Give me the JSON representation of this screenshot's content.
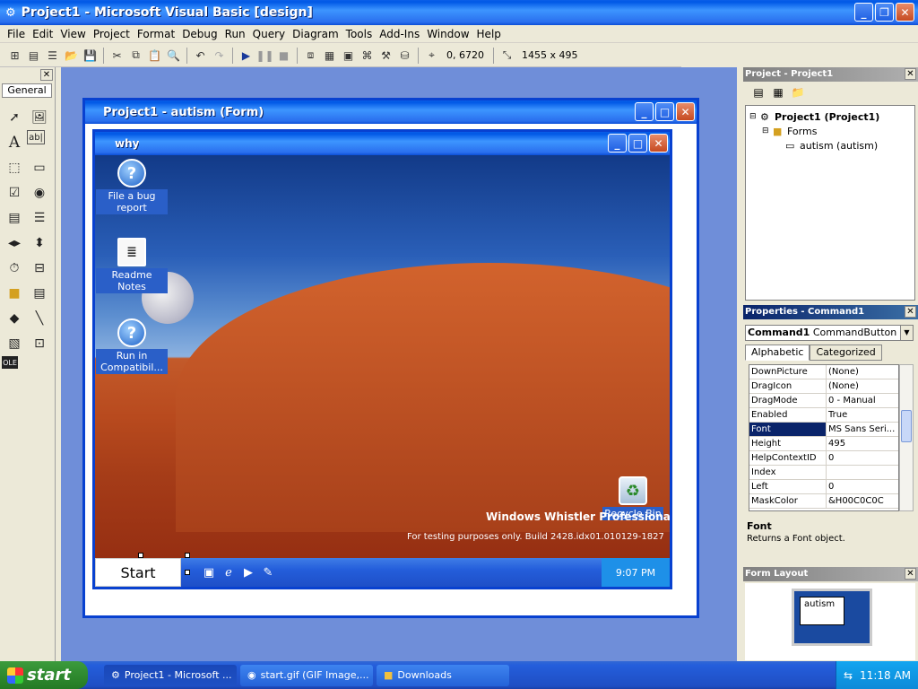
{
  "app": {
    "title": "Project1 - Microsoft Visual Basic [design]"
  },
  "menu": [
    "File",
    "Edit",
    "View",
    "Project",
    "Format",
    "Debug",
    "Run",
    "Query",
    "Diagram",
    "Tools",
    "Add-Ins",
    "Window",
    "Help"
  ],
  "toolbar": {
    "position": "0, 6720",
    "size": "1455 x 495"
  },
  "toolbox": {
    "tab": "General",
    "tools": [
      "pointer-icon",
      "picturebox-icon",
      "label-icon",
      "textbox-icon",
      "frame-icon",
      "commandbutton-icon",
      "checkbox-icon",
      "optionbutton-icon",
      "combobox-icon",
      "listbox-icon",
      "hscrollbar-icon",
      "vscrollbar-icon",
      "timer-icon",
      "drivelist-icon",
      "dirlist-icon",
      "filelist-icon",
      "shape-icon",
      "line-icon",
      "image-icon",
      "data-icon",
      "ole-icon"
    ]
  },
  "form": {
    "title": "Project1 - autism (Form)"
  },
  "why": {
    "title": "why",
    "icons": [
      {
        "label": "File a bug report",
        "icon": "help-shortcut-icon"
      },
      {
        "label": "Readme Notes",
        "icon": "readme-icon"
      },
      {
        "label": "Run in Compatibil...",
        "icon": "help-shortcut-icon"
      },
      {
        "label": "Recycle Bin",
        "icon": "recycle-bin-icon"
      }
    ],
    "brand": "Windows Whistler Professional",
    "build": "For testing purposes only. Build 2428.idx01.010129-1827",
    "start": "Start",
    "clock": "9:07 PM"
  },
  "project_panel": {
    "title": "Project - Project1",
    "tree": [
      {
        "label": "Project1 (Project1)",
        "bold": true
      },
      {
        "label": "Forms",
        "bold": false
      },
      {
        "label": "autism (autism)",
        "bold": false
      }
    ]
  },
  "properties_panel": {
    "title": "Properties - Command1",
    "object_name": "Command1",
    "object_type": "CommandButton",
    "tabs": [
      "Alphabetic",
      "Categorized"
    ],
    "rows": [
      {
        "name": "DownPicture",
        "value": "(None)"
      },
      {
        "name": "DragIcon",
        "value": "(None)"
      },
      {
        "name": "DragMode",
        "value": "0 - Manual"
      },
      {
        "name": "Enabled",
        "value": "True"
      },
      {
        "name": "Font",
        "value": "MS Sans Seri..."
      },
      {
        "name": "Height",
        "value": "495"
      },
      {
        "name": "HelpContextID",
        "value": "0"
      },
      {
        "name": "Index",
        "value": ""
      },
      {
        "name": "Left",
        "value": "0"
      },
      {
        "name": "MaskColor",
        "value": "&H00C0C0C"
      }
    ],
    "desc_title": "Font",
    "desc_text": "Returns a Font object."
  },
  "form_layout": {
    "title": "Form Layout",
    "form_name": "autism"
  },
  "taskbar": {
    "start": "start",
    "buttons": [
      {
        "label": "Project1 - Microsoft ..."
      },
      {
        "label": "start.gif (GIF Image,..."
      },
      {
        "label": "Downloads"
      }
    ],
    "clock": "11:18 AM"
  }
}
